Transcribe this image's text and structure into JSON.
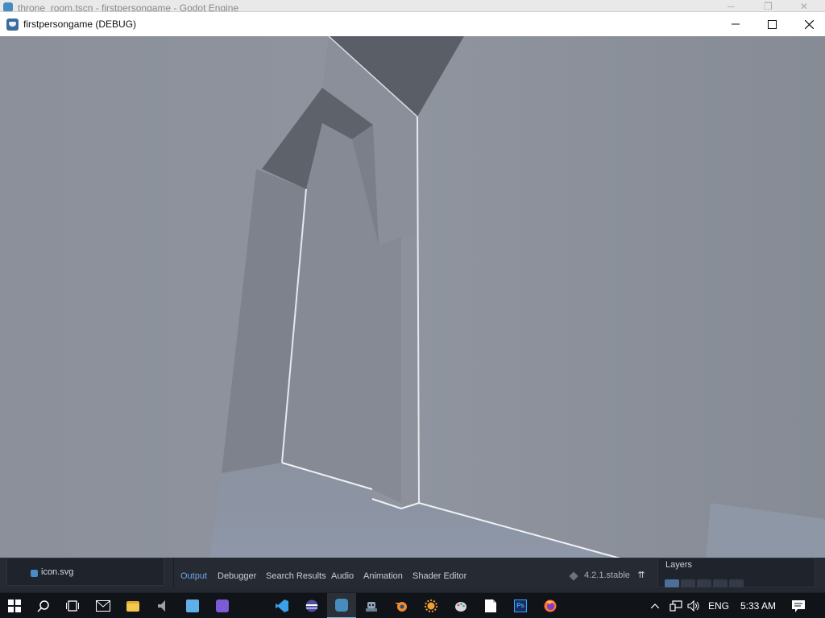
{
  "background_window": {
    "title": "throne_room.tscn - firstpersongame - Godot Engine"
  },
  "game_window": {
    "title": "firstpersongame (DEBUG)",
    "controls": {
      "minimize": "─",
      "maximize": "☐",
      "close": "✕"
    }
  },
  "editor": {
    "filesystem": {
      "file": "icon.svg"
    },
    "bottom_tabs": [
      "Output",
      "Debugger",
      "Search Results",
      "Audio",
      "Animation",
      "Shader Editor"
    ],
    "active_tab": "Output",
    "version": "4.2.1.stable",
    "layers_label": "Layers"
  },
  "taskbar": {
    "apps": [
      {
        "name": "windows-start",
        "icon": "windows-logo-icon",
        "color": "#ffffff"
      },
      {
        "name": "search",
        "icon": "search-icon",
        "color": "#ffffff"
      },
      {
        "name": "task-view",
        "icon": "task-view-icon",
        "color": "#ffffff"
      },
      {
        "name": "mail",
        "icon": "mail-icon",
        "color": "#ffffff"
      },
      {
        "name": "file-explorer",
        "icon": "folder-icon",
        "color": "#f2c94c"
      },
      {
        "name": "audio-app",
        "icon": "speaker-app-icon",
        "color": "#9aa3ad"
      },
      {
        "name": "control-panel",
        "icon": "control-panel-icon",
        "color": "#5fb0e8"
      },
      {
        "name": "notes-app",
        "icon": "notes-app-icon",
        "color": "#7b5cd6"
      },
      {
        "name": "vscode",
        "icon": "vscode-icon",
        "color": "#3aa0e8"
      },
      {
        "name": "app-stripe",
        "icon": "striped-app-icon",
        "color": "#4b4f9c"
      },
      {
        "name": "godot",
        "icon": "godot-icon",
        "color": "#478cbf",
        "active": true
      },
      {
        "name": "game-app",
        "icon": "robot-icon",
        "color": "#8fa3b8"
      },
      {
        "name": "blender",
        "icon": "blender-icon",
        "color": "#f08c2e"
      },
      {
        "name": "sun-app",
        "icon": "sun-icon",
        "color": "#f0a030"
      },
      {
        "name": "paint-app",
        "icon": "palette-icon",
        "color": "#d8d8d8"
      },
      {
        "name": "notepad",
        "icon": "document-icon",
        "color": "#ffffff"
      },
      {
        "name": "photoshop",
        "icon": "photoshop-icon",
        "color": "#1b2b5a",
        "label": "Ps"
      },
      {
        "name": "firefox",
        "icon": "firefox-icon",
        "color": "#ff7139"
      }
    ],
    "tray": {
      "language": "ENG",
      "time": "5:33 AM"
    }
  }
}
